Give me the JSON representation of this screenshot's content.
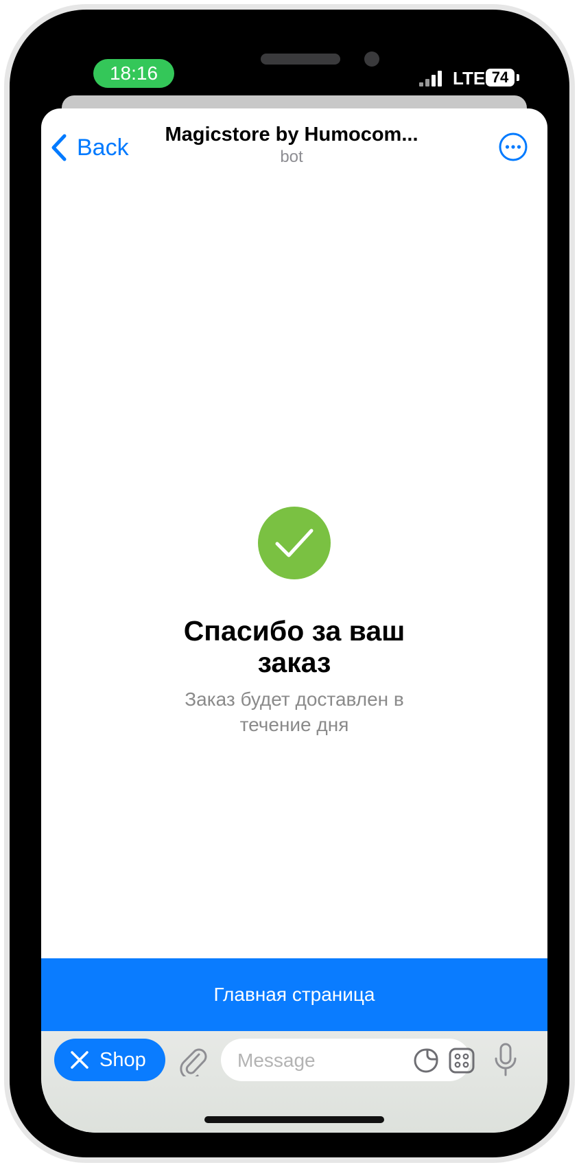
{
  "status_bar": {
    "time": "18:16",
    "network": "LTE",
    "battery": "74"
  },
  "header": {
    "back_label": "Back",
    "title": "Magicstore by Humocom...",
    "subtitle": "bot"
  },
  "confirmation": {
    "title": "Спасибо за ваш заказ",
    "message": "Заказ будет доставлен в течение дня"
  },
  "main_button_label": "Главная страница",
  "input_bar": {
    "shop_label": "Shop",
    "placeholder": "Message"
  },
  "colors": {
    "accent": "#0a7cff",
    "success": "#7ac142",
    "status_pill": "#34c759"
  }
}
